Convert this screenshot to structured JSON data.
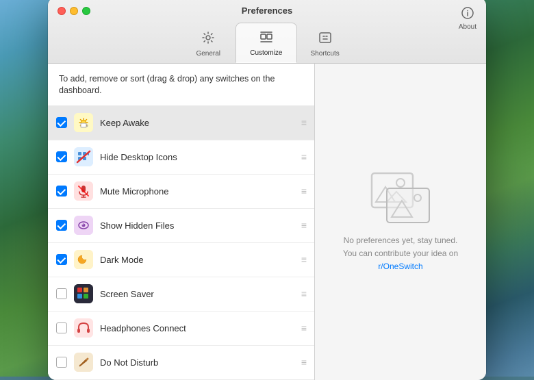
{
  "window": {
    "title": "Preferences"
  },
  "toolbar": {
    "items": [
      {
        "id": "general",
        "label": "General",
        "icon": "⚙️",
        "active": false
      },
      {
        "id": "customize",
        "label": "Customize",
        "icon": "↔",
        "active": true
      },
      {
        "id": "shortcuts",
        "label": "Shortcuts",
        "icon": "⌘",
        "active": false
      }
    ],
    "about_label": "About"
  },
  "instruction": "To add, remove or sort (drag & drop) any switches on the dashboard.",
  "switches": [
    {
      "id": "keep-awake",
      "name": "Keep Awake",
      "checked": true,
      "highlighted": true
    },
    {
      "id": "hide-desktop-icons",
      "name": "Hide Desktop Icons",
      "checked": true,
      "highlighted": false
    },
    {
      "id": "mute-microphone",
      "name": "Mute Microphone",
      "checked": true,
      "highlighted": false
    },
    {
      "id": "show-hidden-files",
      "name": "Show Hidden Files",
      "checked": true,
      "highlighted": false
    },
    {
      "id": "dark-mode",
      "name": "Dark Mode",
      "checked": true,
      "highlighted": false
    },
    {
      "id": "screen-saver",
      "name": "Screen Saver",
      "checked": false,
      "highlighted": false
    },
    {
      "id": "headphones-connect",
      "name": "Headphones Connect",
      "checked": false,
      "highlighted": false
    },
    {
      "id": "do-not-disturb",
      "name": "Do Not Disturb",
      "checked": false,
      "highlighted": false
    }
  ],
  "right_panel": {
    "placeholder_text": "No preferences yet, stay tuned.",
    "placeholder_subtext": "You can contribute your idea on ",
    "link_text": "r/OneSwitch",
    "link_url": "#"
  }
}
